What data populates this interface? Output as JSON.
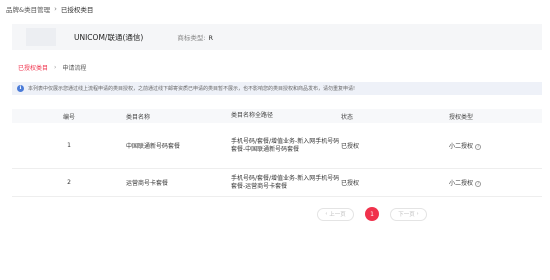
{
  "breadcrumb": {
    "parent": "品牌&类目管理",
    "current": "已授权类目"
  },
  "brand": {
    "name": "UNICOM/联通(通信)",
    "type_label": "商标类型:",
    "type_value": "R"
  },
  "steps": {
    "active": "已授权类目",
    "inactive": "申请流程"
  },
  "notice": "本列表中仅展示您通过线上流程申请的类目授权，之前通过线下邮寄资质已申请的类目暂不展示，也不影响您的类目授权和商品发布，请勿重复申请!",
  "table": {
    "headers": [
      "编号",
      "类目名称",
      "类目名称全路径",
      "状态",
      "授权类型"
    ],
    "rows": [
      {
        "id": "1",
        "name": "中国联通新号码套餐",
        "path": "手机号码/套餐/增值业务-新入网手机号码套餐-中国联通新号码套餐",
        "status": "已授权",
        "auth_type": "小二授权"
      },
      {
        "id": "2",
        "name": "运营商号卡套餐",
        "path": "手机号码/套餐/增值业务-新入网手机号码套餐-运营商号卡套餐",
        "status": "已授权",
        "auth_type": "小二授权"
      }
    ]
  },
  "pager": {
    "prev": "上一页",
    "current": "1",
    "next": "下一页"
  },
  "icons": {
    "info": "info-icon",
    "help": "question-circle-icon",
    "chevron": "chevron-right-icon"
  },
  "colors": {
    "accent": "#f0324c",
    "info": "#4a7bd8"
  }
}
